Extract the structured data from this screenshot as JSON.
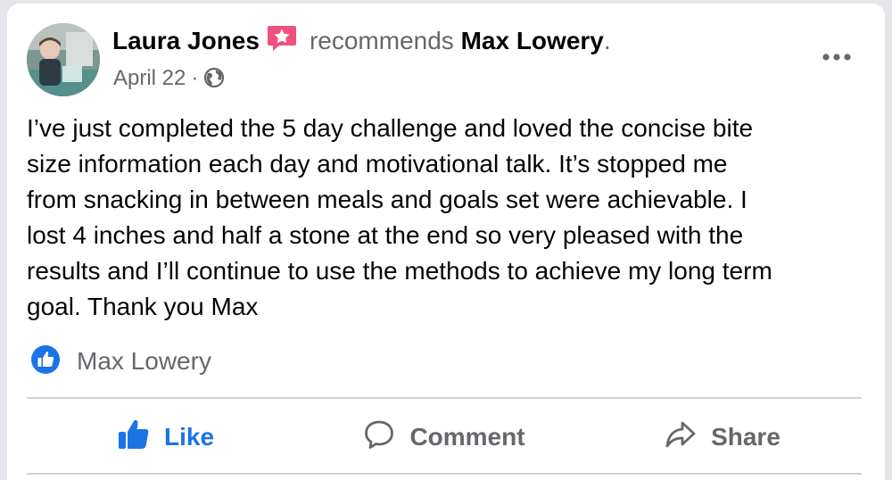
{
  "post": {
    "author": "Laura Jones",
    "verb": "recommends",
    "target": "Max Lowery",
    "period": ".",
    "date": "April 22",
    "separator": "·",
    "audience_icon": "globe-icon",
    "body": "I’ve just completed the 5 day challenge and loved the concise bite\nsize information each day and motivational talk. It’s stopped me\nfrom snacking in between meals and goals set were achievable. I\nlost 4 inches and half a stone at the end so very pleased with the\nresults and I’ll continue to use the methods to achieve my long term\ngoal. Thank you Max"
  },
  "reactions": {
    "icon": "like-reaction-icon",
    "names": "Max Lowery"
  },
  "actions": {
    "like": "Like",
    "comment": "Comment",
    "share": "Share"
  },
  "colors": {
    "brand_blue": "#1b74e4",
    "badge_pink": "#f0507d",
    "secondary_text": "#65676b",
    "divider": "#ced0d4"
  }
}
